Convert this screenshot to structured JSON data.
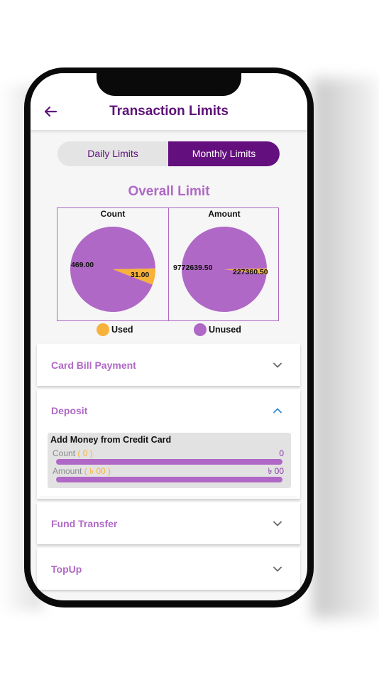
{
  "header": {
    "title": "Transaction Limits"
  },
  "tabs": {
    "daily": "Daily Limits",
    "monthly": "Monthly Limits",
    "selected": "monthly"
  },
  "overall": {
    "title": "Overall Limit",
    "count_label": "Count",
    "amount_label": "Amount",
    "count": {
      "used": 31.0,
      "unused": 469.0,
      "used_text": "31.00",
      "unused_text": "469.00"
    },
    "amount": {
      "used": 227360.5,
      "unused": 9772639.5,
      "used_text": "227360.50",
      "unused_text": "9772639.50"
    },
    "legend": {
      "used": "Used",
      "unused": "Unused"
    },
    "colors": {
      "used": "#f7b23b",
      "unused": "#b068c6"
    }
  },
  "sections": {
    "card_bill": "Card Bill Payment",
    "deposit": "Deposit",
    "fund_transfer": "Fund Transfer",
    "topup": "TopUp"
  },
  "deposit_detail": {
    "title": "Add Money from Credit Card",
    "count_label": "Count",
    "count_paren": "( 0 )",
    "count_value": "0",
    "amount_label": "Amount",
    "amount_paren": "( ৳ 00 )",
    "amount_value": "৳ 00"
  }
}
